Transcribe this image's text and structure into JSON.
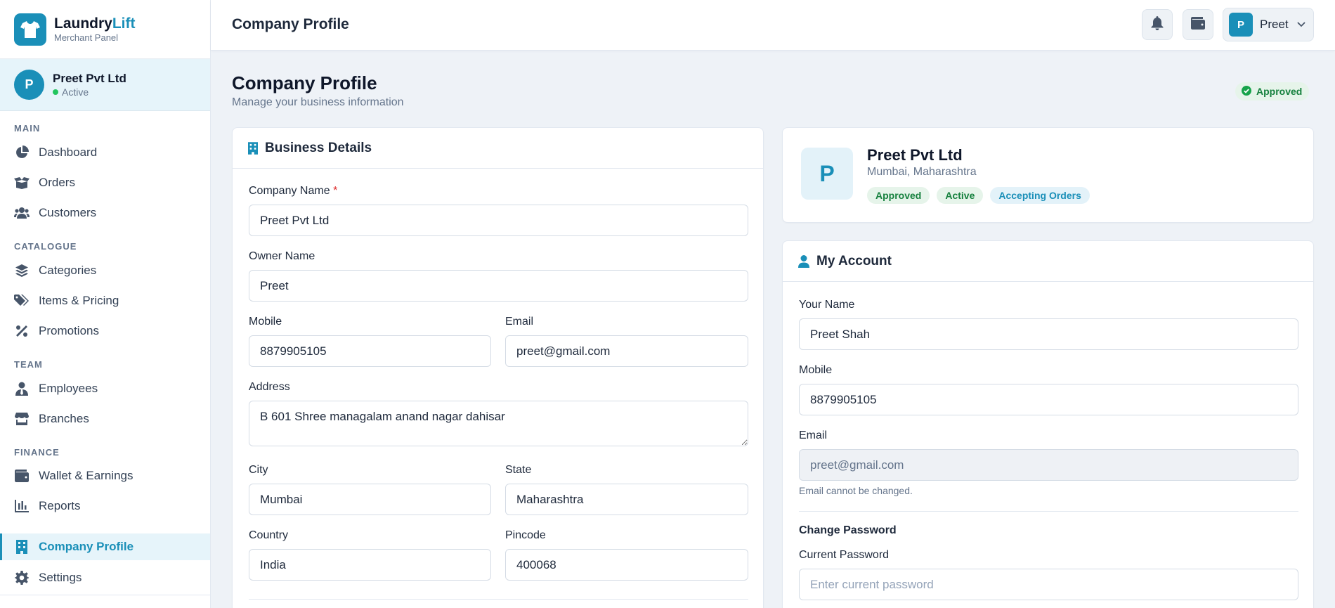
{
  "brand": {
    "name_main": "Laundry",
    "name_accent": "Lift",
    "subtitle": "Merchant Panel"
  },
  "company": {
    "initial": "P",
    "name": "Preet Pvt Ltd",
    "status": "Active"
  },
  "nav": {
    "sections": {
      "main": "MAIN",
      "catalogue": "CATALOGUE",
      "team": "TEAM",
      "finance": "FINANCE"
    },
    "items": {
      "dashboard": "Dashboard",
      "orders": "Orders",
      "customers": "Customers",
      "categories": "Categories",
      "items_pricing": "Items & Pricing",
      "promotions": "Promotions",
      "employees": "Employees",
      "branches": "Branches",
      "wallet": "Wallet & Earnings",
      "reports": "Reports",
      "company_profile": "Company Profile",
      "settings": "Settings"
    }
  },
  "header": {
    "title": "Company Profile",
    "user_initial": "P",
    "user_name": "Preet"
  },
  "page": {
    "title": "Company Profile",
    "subtitle": "Manage your business information",
    "status_pill": "Approved"
  },
  "business": {
    "heading": "Business Details",
    "company_name_label": "Company Name",
    "required_mark": "*",
    "company_name": "Preet Pvt Ltd",
    "owner_label": "Owner Name",
    "owner": "Preet",
    "mobile_label": "Mobile",
    "mobile": "8879905105",
    "email_label": "Email",
    "email": "preet@gmail.com",
    "address_label": "Address",
    "address": "B 601 Shree managalam anand nagar dahisar",
    "city_label": "City",
    "city": "Mumbai",
    "state_label": "State",
    "state": "Maharashtra",
    "country_label": "Country",
    "country": "India",
    "pincode_label": "Pincode",
    "pincode": "400068"
  },
  "profile_card": {
    "initial": "P",
    "name": "Preet Pvt Ltd",
    "location": "Mumbai, Maharashtra",
    "badges": {
      "approved": "Approved",
      "active": "Active",
      "accepting": "Accepting Orders"
    }
  },
  "account": {
    "heading": "My Account",
    "name_label": "Your Name",
    "name": "Preet Shah",
    "mobile_label": "Mobile",
    "mobile": "8879905105",
    "email_label": "Email",
    "email": "preet@gmail.com",
    "email_hint": "Email cannot be changed.",
    "change_password": "Change Password",
    "current_password_label": "Current Password",
    "current_password_placeholder": "Enter current password"
  },
  "colors": {
    "accent": "#1a8fb8",
    "success": "#15803d",
    "danger": "#dc2626"
  }
}
